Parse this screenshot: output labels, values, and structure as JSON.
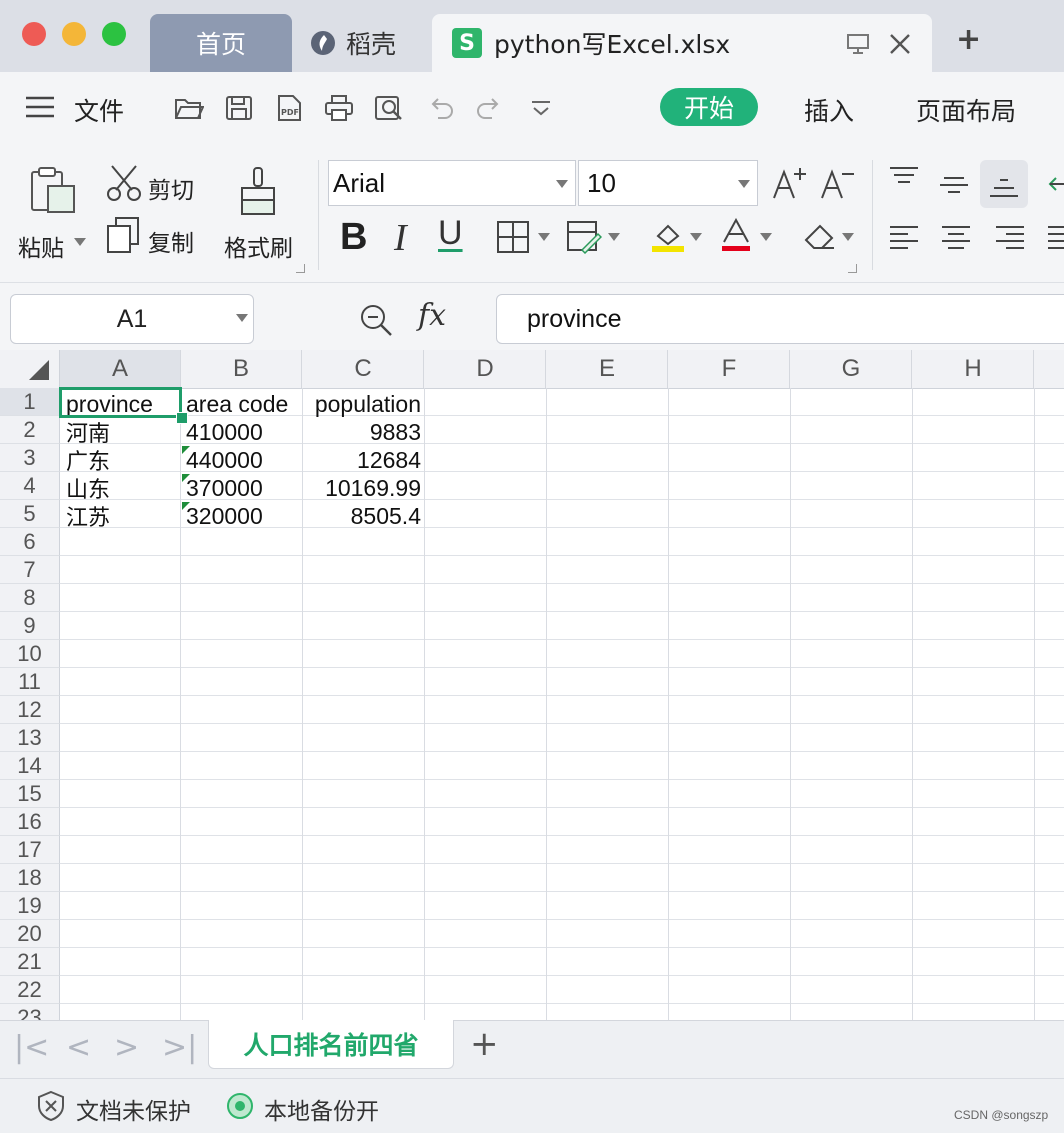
{
  "window": {
    "tabs": [
      {
        "label": "首页"
      },
      {
        "label": "稻壳"
      },
      {
        "label": "python写Excel.xlsx"
      }
    ],
    "new_tab": "+"
  },
  "menu": {
    "file": "文件",
    "tabs": [
      "开始",
      "插入",
      "页面布局"
    ]
  },
  "ribbon": {
    "paste": "粘贴",
    "cut": "剪切",
    "copy": "复制",
    "format_painter": "格式刷",
    "font_name": "Arial",
    "font_size": "10",
    "bold": "B",
    "italic": "I",
    "underline": "U"
  },
  "formula_bar": {
    "cell_ref": "A1",
    "fx": "fx",
    "content": "province"
  },
  "grid": {
    "columns": [
      "A",
      "B",
      "C",
      "D",
      "E",
      "F",
      "G",
      "H"
    ],
    "rows": [
      "1",
      "2",
      "3",
      "4",
      "5",
      "6",
      "7",
      "8",
      "9",
      "10",
      "11",
      "12",
      "13",
      "14",
      "15",
      "16",
      "17",
      "18",
      "19",
      "20",
      "21",
      "22",
      "23"
    ],
    "header": {
      "a": "province",
      "b": "area  code",
      "c": "population"
    },
    "data": [
      {
        "province": "河南",
        "code": "410000",
        "population": "9883"
      },
      {
        "province": "广东",
        "code": "440000",
        "population": "12684"
      },
      {
        "province": "山东",
        "code": "370000",
        "population": "10169.99"
      },
      {
        "province": "江苏",
        "code": "320000",
        "population": "8505.4"
      }
    ]
  },
  "sheets": {
    "active": "人口排名前四省",
    "add": "+"
  },
  "status": {
    "protect": "文档未保护",
    "backup": "本地备份开",
    "watermark": "CSDN @songszp"
  },
  "colors": {
    "accent": "#21b27a",
    "selection": "#1f9d6a",
    "tab_home": "#8e9ab1"
  }
}
